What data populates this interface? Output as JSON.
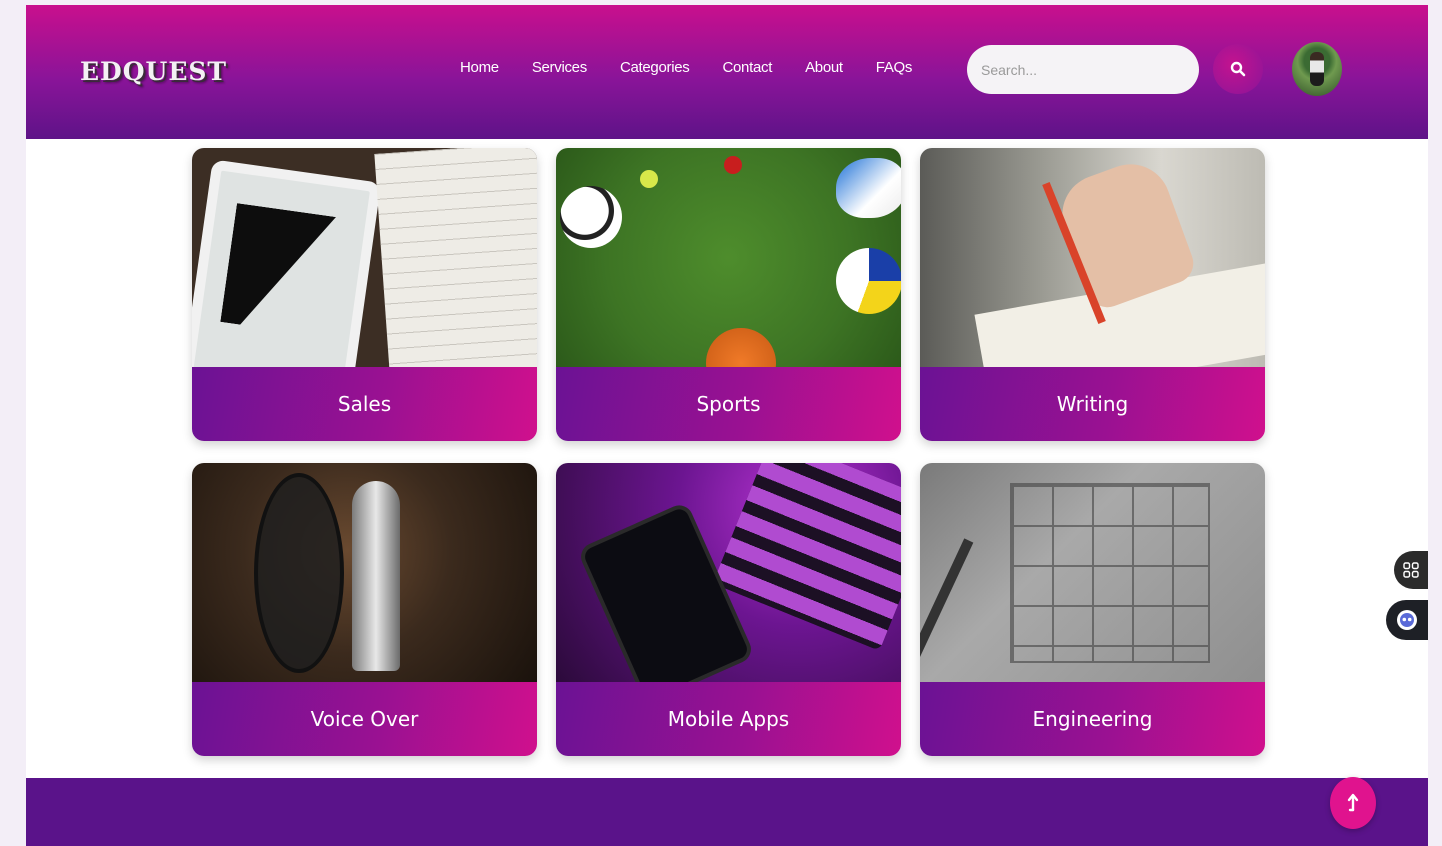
{
  "brand": {
    "logo_text": "EDQUEST"
  },
  "nav": {
    "items": [
      "Home",
      "Services",
      "Categories",
      "Contact",
      "About",
      "FAQs"
    ]
  },
  "search": {
    "placeholder": "Search..."
  },
  "icons": {
    "search": "search-icon",
    "avatar": "user-avatar",
    "grid_widget": "grid-icon",
    "chat_widget": "chat-bot-icon",
    "back_to_top": "arrow-up-icon"
  },
  "categories": [
    {
      "label": "Sales"
    },
    {
      "label": "Sports"
    },
    {
      "label": "Writing"
    },
    {
      "label": "Voice Over"
    },
    {
      "label": "Mobile Apps"
    },
    {
      "label": "Engineering"
    }
  ],
  "colors": {
    "header_top": "#c90f8d",
    "header_bottom": "#5e1388",
    "card_bar_start": "#6b1294",
    "card_bar_end": "#d0108d",
    "footer": "#5a138a",
    "back_to_top": "#e0138e"
  }
}
